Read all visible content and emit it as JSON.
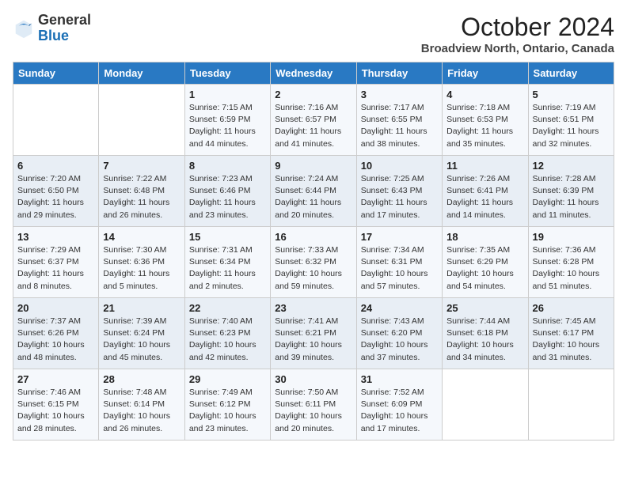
{
  "header": {
    "logo_general": "General",
    "logo_blue": "Blue",
    "month_title": "October 2024",
    "location": "Broadview North, Ontario, Canada"
  },
  "days_of_week": [
    "Sunday",
    "Monday",
    "Tuesday",
    "Wednesday",
    "Thursday",
    "Friday",
    "Saturday"
  ],
  "weeks": [
    [
      {
        "day": "",
        "content": ""
      },
      {
        "day": "",
        "content": ""
      },
      {
        "day": "1",
        "content": "Sunrise: 7:15 AM\nSunset: 6:59 PM\nDaylight: 11 hours and 44 minutes."
      },
      {
        "day": "2",
        "content": "Sunrise: 7:16 AM\nSunset: 6:57 PM\nDaylight: 11 hours and 41 minutes."
      },
      {
        "day": "3",
        "content": "Sunrise: 7:17 AM\nSunset: 6:55 PM\nDaylight: 11 hours and 38 minutes."
      },
      {
        "day": "4",
        "content": "Sunrise: 7:18 AM\nSunset: 6:53 PM\nDaylight: 11 hours and 35 minutes."
      },
      {
        "day": "5",
        "content": "Sunrise: 7:19 AM\nSunset: 6:51 PM\nDaylight: 11 hours and 32 minutes."
      }
    ],
    [
      {
        "day": "6",
        "content": "Sunrise: 7:20 AM\nSunset: 6:50 PM\nDaylight: 11 hours and 29 minutes."
      },
      {
        "day": "7",
        "content": "Sunrise: 7:22 AM\nSunset: 6:48 PM\nDaylight: 11 hours and 26 minutes."
      },
      {
        "day": "8",
        "content": "Sunrise: 7:23 AM\nSunset: 6:46 PM\nDaylight: 11 hours and 23 minutes."
      },
      {
        "day": "9",
        "content": "Sunrise: 7:24 AM\nSunset: 6:44 PM\nDaylight: 11 hours and 20 minutes."
      },
      {
        "day": "10",
        "content": "Sunrise: 7:25 AM\nSunset: 6:43 PM\nDaylight: 11 hours and 17 minutes."
      },
      {
        "day": "11",
        "content": "Sunrise: 7:26 AM\nSunset: 6:41 PM\nDaylight: 11 hours and 14 minutes."
      },
      {
        "day": "12",
        "content": "Sunrise: 7:28 AM\nSunset: 6:39 PM\nDaylight: 11 hours and 11 minutes."
      }
    ],
    [
      {
        "day": "13",
        "content": "Sunrise: 7:29 AM\nSunset: 6:37 PM\nDaylight: 11 hours and 8 minutes."
      },
      {
        "day": "14",
        "content": "Sunrise: 7:30 AM\nSunset: 6:36 PM\nDaylight: 11 hours and 5 minutes."
      },
      {
        "day": "15",
        "content": "Sunrise: 7:31 AM\nSunset: 6:34 PM\nDaylight: 11 hours and 2 minutes."
      },
      {
        "day": "16",
        "content": "Sunrise: 7:33 AM\nSunset: 6:32 PM\nDaylight: 10 hours and 59 minutes."
      },
      {
        "day": "17",
        "content": "Sunrise: 7:34 AM\nSunset: 6:31 PM\nDaylight: 10 hours and 57 minutes."
      },
      {
        "day": "18",
        "content": "Sunrise: 7:35 AM\nSunset: 6:29 PM\nDaylight: 10 hours and 54 minutes."
      },
      {
        "day": "19",
        "content": "Sunrise: 7:36 AM\nSunset: 6:28 PM\nDaylight: 10 hours and 51 minutes."
      }
    ],
    [
      {
        "day": "20",
        "content": "Sunrise: 7:37 AM\nSunset: 6:26 PM\nDaylight: 10 hours and 48 minutes."
      },
      {
        "day": "21",
        "content": "Sunrise: 7:39 AM\nSunset: 6:24 PM\nDaylight: 10 hours and 45 minutes."
      },
      {
        "day": "22",
        "content": "Sunrise: 7:40 AM\nSunset: 6:23 PM\nDaylight: 10 hours and 42 minutes."
      },
      {
        "day": "23",
        "content": "Sunrise: 7:41 AM\nSunset: 6:21 PM\nDaylight: 10 hours and 39 minutes."
      },
      {
        "day": "24",
        "content": "Sunrise: 7:43 AM\nSunset: 6:20 PM\nDaylight: 10 hours and 37 minutes."
      },
      {
        "day": "25",
        "content": "Sunrise: 7:44 AM\nSunset: 6:18 PM\nDaylight: 10 hours and 34 minutes."
      },
      {
        "day": "26",
        "content": "Sunrise: 7:45 AM\nSunset: 6:17 PM\nDaylight: 10 hours and 31 minutes."
      }
    ],
    [
      {
        "day": "27",
        "content": "Sunrise: 7:46 AM\nSunset: 6:15 PM\nDaylight: 10 hours and 28 minutes."
      },
      {
        "day": "28",
        "content": "Sunrise: 7:48 AM\nSunset: 6:14 PM\nDaylight: 10 hours and 26 minutes."
      },
      {
        "day": "29",
        "content": "Sunrise: 7:49 AM\nSunset: 6:12 PM\nDaylight: 10 hours and 23 minutes."
      },
      {
        "day": "30",
        "content": "Sunrise: 7:50 AM\nSunset: 6:11 PM\nDaylight: 10 hours and 20 minutes."
      },
      {
        "day": "31",
        "content": "Sunrise: 7:52 AM\nSunset: 6:09 PM\nDaylight: 10 hours and 17 minutes."
      },
      {
        "day": "",
        "content": ""
      },
      {
        "day": "",
        "content": ""
      }
    ]
  ]
}
